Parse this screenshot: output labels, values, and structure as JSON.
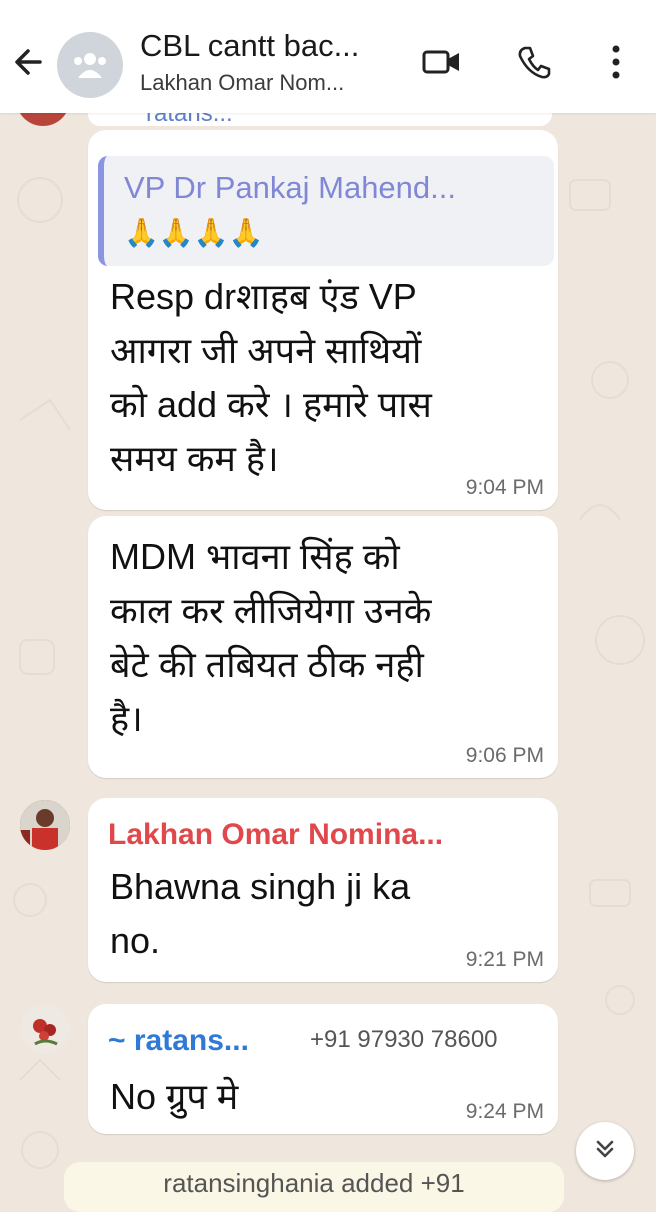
{
  "header": {
    "title": "CBL cantt bac...",
    "subtitle": "Lakhan Omar Nom...",
    "icons": [
      "back-arrow-icon",
      "group-avatar-icon",
      "video-call-icon",
      "voice-call-icon",
      "more-vert-icon"
    ]
  },
  "peek": {
    "name": "ratans..."
  },
  "messages": [
    {
      "quote_name": "VP Dr Pankaj Mahend...",
      "quote_text": "🙏🙏🙏🙏",
      "lines": [
        "Resp drशाहब एंड VP",
        "आगरा जी अपने साथियों",
        "को add करे । हमारे पास",
        "समय कम है।"
      ],
      "time": "9:04 PM"
    },
    {
      "lines": [
        "MDM भावना सिंह को",
        "काल कर लीजियेगा उनके",
        "बेटे की तबियत ठीक नही",
        "है।"
      ],
      "time": "9:06 PM"
    },
    {
      "sender": "Lakhan Omar Nomina...",
      "sender_color": "#e0484b",
      "lines": [
        "Bhawna  singh ji ka",
        "no."
      ],
      "time": "9:21 PM"
    },
    {
      "sender": "~ ratans...",
      "sender_color": "#2f7ad6",
      "phone": "+91 97930 78600",
      "lines": [
        "No ग्रुप मे"
      ],
      "time": "9:24 PM"
    }
  ],
  "system_peek": "ratansinghania added +91",
  "colors": {
    "background": "#efe7de",
    "bubble": "#ffffff",
    "quote_bar": "#8a94e0"
  }
}
